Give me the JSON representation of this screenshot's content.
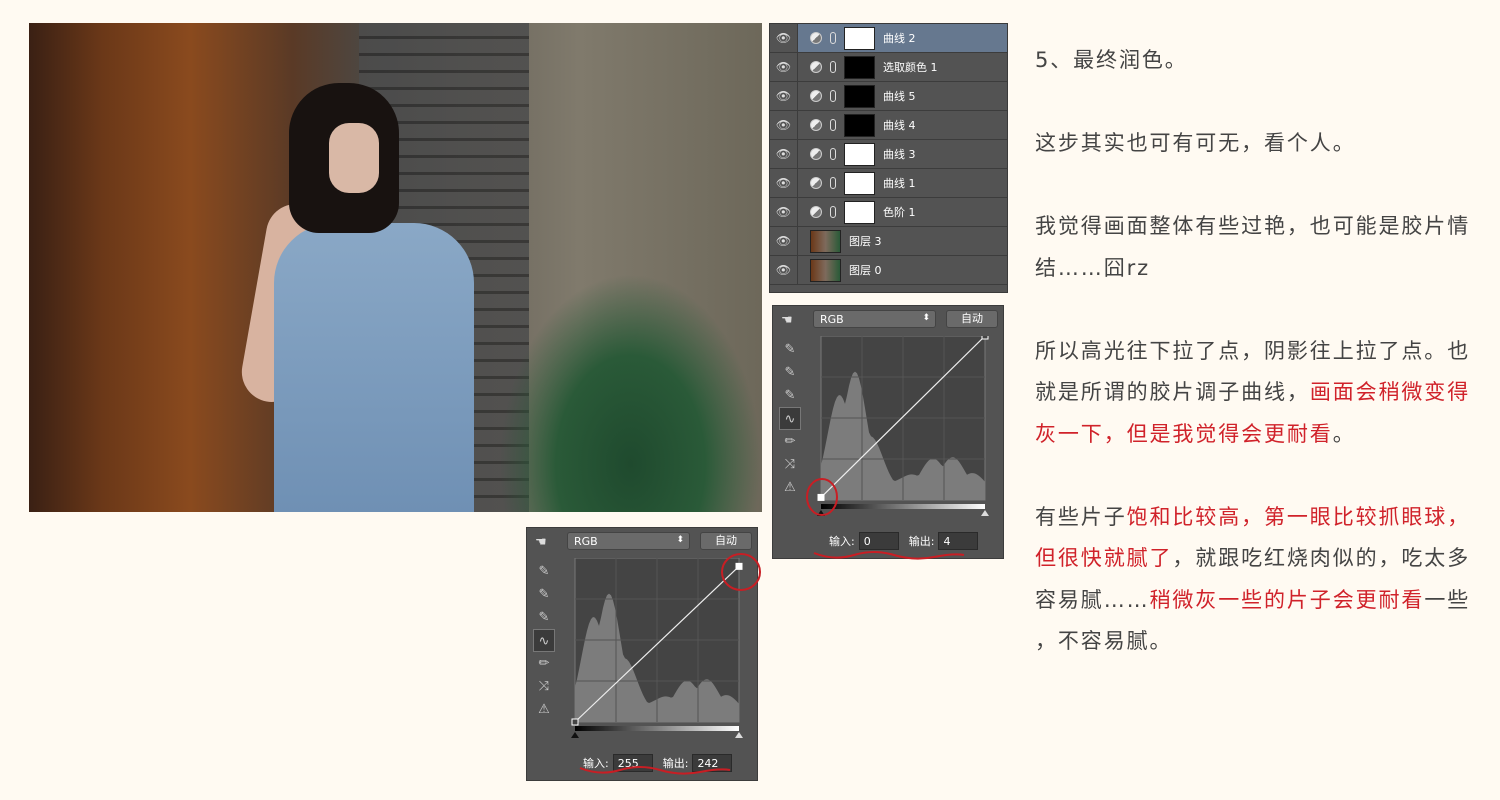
{
  "photo": {
    "alt": ""
  },
  "layers": [
    {
      "name": "曲线 2",
      "mask": "w",
      "selected": true
    },
    {
      "name": "选取颜色 1",
      "mask": "b"
    },
    {
      "name": "曲线 5",
      "mask": "b"
    },
    {
      "name": "曲线 4",
      "mask": "b"
    },
    {
      "name": "曲线 3",
      "mask": "w"
    },
    {
      "name": "曲线 1",
      "mask": "w"
    },
    {
      "name": "色阶 1",
      "mask": "w"
    },
    {
      "name": "图层 3",
      "mask": "img"
    },
    {
      "name": "图层 0",
      "mask": "img"
    }
  ],
  "curves_shadow": {
    "channel": "RGB",
    "auto": "自动",
    "input_label": "输入:",
    "input": "0",
    "output_label": "输出:",
    "output": "4"
  },
  "curves_highlight": {
    "channel": "RGB",
    "auto": "自动",
    "input_label": "输入:",
    "input": "255",
    "output_label": "输出:",
    "output": "242"
  },
  "colors": {
    "accent_red": "#d0222a",
    "text": "#444444",
    "background": "#fffaf2",
    "panel": "#535353"
  },
  "text_lines": [
    [
      {
        "t": "5、最终润色。"
      }
    ],
    [],
    [
      {
        "t": "这步其实也可有可无，看个人。"
      }
    ],
    [],
    [
      {
        "t": "我觉得画面整体有些过艳，也可能是胶片情"
      }
    ],
    [
      {
        "t": "结……囧rz"
      }
    ],
    [],
    [
      {
        "t": "所以高光往下拉了点，阴影往上拉了点。也"
      }
    ],
    [
      {
        "t": "就是所谓的胶片调子曲线，"
      },
      {
        "t": "画面会稍微变得",
        "red": true
      }
    ],
    [
      {
        "t": "灰一下，但是我觉得会更耐看",
        "red": true
      },
      {
        "t": "。"
      }
    ],
    [],
    [
      {
        "t": "有些片子"
      },
      {
        "t": "饱和比较高，第一眼比较抓眼球，",
        "red": true
      }
    ],
    [
      {
        "t": "但很快就腻了",
        "red": true
      },
      {
        "t": "，就跟吃红烧肉似的，吃太多"
      }
    ],
    [
      {
        "t": "容易腻……"
      },
      {
        "t": "稍微灰一些的片子会更耐看",
        "red": true
      },
      {
        "t": "一些"
      }
    ],
    [
      {
        "t": "，不容易腻。"
      }
    ]
  ]
}
